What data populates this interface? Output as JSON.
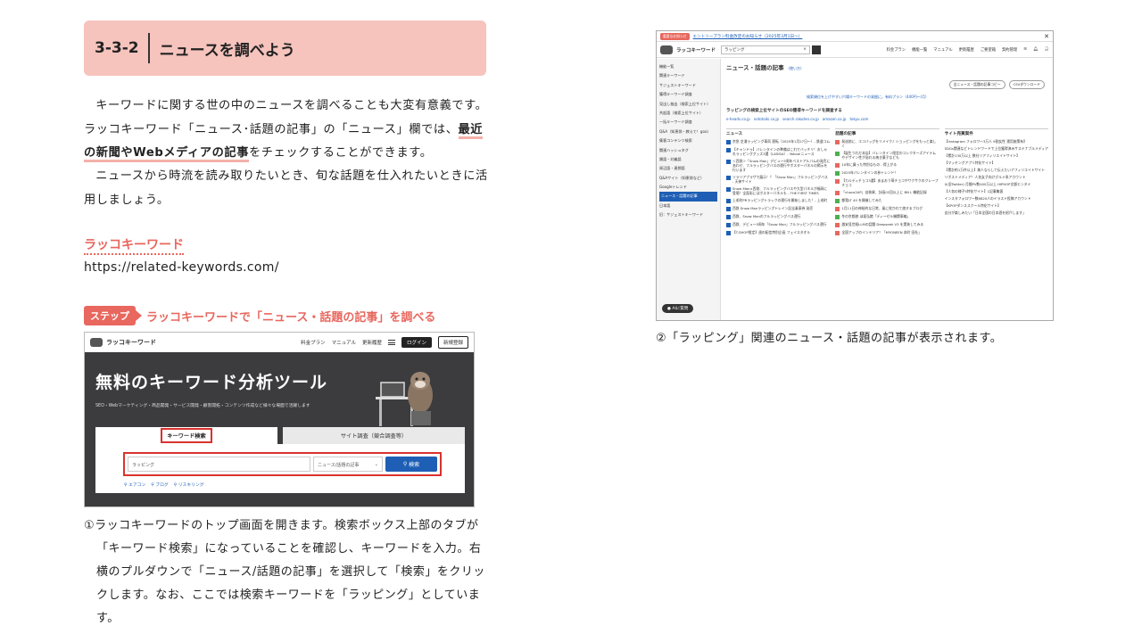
{
  "section": {
    "number": "3-3-2",
    "title": "ニュースを調べよう"
  },
  "body": {
    "para1_a": "キーワードに関する世の中のニュースを調べることも大変有意義です。ラッコキーワード「ニュース･話題の記事」の「ニュース」欄では、",
    "para1_highlight": "最近の新聞やWebメディアの記事",
    "para1_b": "をチェックすることができます。",
    "para2": "ニュースから時流を読み取りたいとき、旬な話題を仕入れたいときに活用しましょう。"
  },
  "resource": {
    "label": "ラッコキーワード",
    "url": "https://related-keywords.com/"
  },
  "step": {
    "badge": "ステップ",
    "text": "ラッコキーワードで「ニュース・話題の記事」を調べる"
  },
  "shot1": {
    "logo": "ラッコキーワード",
    "nav": [
      "料金プラン",
      "マニュアル",
      "更新履歴"
    ],
    "login": "ログイン",
    "register": "新規登録",
    "hero_title": "無料のキーワード分析ツール",
    "hero_sub": "SEO・Webマーケティング・商品開発・サービス開発・顧客開拓・コンテンツ作成など様々な場面で活躍します",
    "tab_active": "キーワード検索",
    "tab_inactive": "サイト調査（競合調査等）",
    "search_value": "ラッピング",
    "select_value": "ニュース/話題の記事",
    "search_button": "検索",
    "links": [
      "エアコン",
      "ブログ",
      "リスキリング"
    ]
  },
  "caption1": "①ラッコキーワードのトップ画面を開きます。検索ボックス上部のタブが「キーワード検索」になっていることを確認し、キーワードを入力。右横のプルダウンで「ニュース/話題の記事」を選択して「検索」をクリックします。なお、ここでは検索キーワードを「ラッピング」としています。",
  "shot2": {
    "notice_badge": "重要なお知らせ",
    "notice_text": "エントリープラン料金改定のお知らせ（2025年3月1日～）",
    "logo": "ラッコキーワード",
    "search_value": "ラッピング",
    "nav": [
      "料金プラン",
      "機能一覧",
      "マニュアル",
      "更新履歴",
      "ご要望箱",
      "契約管理"
    ],
    "sidebar": [
      "機能一覧",
      "関連キーワード",
      "サジェストキーワード",
      "獲得キーワード調査",
      "見出し抽出（検索上位サイト）",
      "共起語（検索上位サイト）",
      "一括キーワード調査",
      "Q&A（知恵袋・教えて！goo）",
      "集客コンテンツ検索",
      "関連ハッシュタグ",
      "類語・対義語",
      "周辺語・連想語",
      "Q&Aサイト（知恵袋など）",
      "Googleトレンド",
      "ニュース・話題の記事",
      "日本語",
      "旧：サジェストキーワード"
    ],
    "ai_label": "AIに質問",
    "title": "ニュース・話題の記事",
    "title_note": "（使い方）",
    "btn_copy": "全ニュース・話題の記事コピー",
    "btn_csv": "CSVダウンロード",
    "promo": "検索順位を上げやすい穴場キーワードの発掘に。有料プラン（440円〜/月）",
    "h2": "ラッピングの検索上位サイトのSEO獲得キーワードを調査する",
    "sites": [
      "e-heads.co.jp",
      "nototoiki.co.jp",
      "search.rakuten.co.jp",
      "amazon.co.jp",
      "tokyu.com"
    ],
    "col_news": "ニュース",
    "col_topics": "話題の記事",
    "col_ranking": "サイト売買案件",
    "news": [
      "京急 芝浦ラッピング車両 運転（2025年1月27日～）- 鉄道コム",
      "【キャンドゥ】バレンタインの準備はこれでバッチリ！おしゃれラッピンググッズ3選（LASISA）- Yahoo!ニュース",
      "＜西鉄＞「Snow Man」デビュー5周年ベストアルバムの発売にあわせ、フルラッピングバスの運行やポスターパネルの掲示を行います",
      "ソラリアプラザで展示！？「Snow Man」フルラッピングバス - 天神サイト",
      "Snow Man×西鉄、フルラッピングバスや大型パネルが福岡に登場！全面彩にはポスターパネルも - THE FIRST TIMES",
      "上毛町PRラッピングトラックの運行を開始しました！- 上毛町",
      "西鉄 Snow Manラッピングトレイン記念乗車券 発売",
      "西鉄、Snow Manのフルラッピングバス運行",
      "西鉄、デビュー5周年「Snow Man」フルラッピングバス運行",
      "【T-SHOP限定】週の配信特別企画 フェイスタオル"
    ],
    "topics": [
      "発送前に、エコバッグをリメイク♪ ショッピングをもっと楽しく",
      "【誕生うれだ本店】バレンタイン限定のコレクターズアイテムやデザイン性が溢れる焼き菓子なども",
      "10年に買った特別なもの - 得上がる",
      "2025年バレンタインの参トレンド！",
      "【カルディチョコ3選】あまおう苺チョコやサクサクのクレープチョコ",
      "「choco2AP」自装貨、計画02回以上に BN L 機能記録",
      "都電LT 40 を開催してみた",
      "1月11日の神秘的な日常、風に吹かれて旅するブログ",
      "冬の京都旅 ほ坂弘館「ディーゼル機関車編」",
      "激安見世紙LLMの話題 Deepseek V3 を実装してみる",
      "全国アップのインテリア！「MYONEEN 本町 田杜」"
    ],
    "ranking": [
      "【Instagram フォロワー3万人 9割女性 運用施策有】",
      "SDGs関連などトレンドワードで上位獲得済みサステナブルメディア",
      "【累計130万以上 数社リアフィリエイトサイト】",
      "【マッチングアプリ特化サイト】",
      "【累計約1万件以上】美人ならして伝えたいアフィリエイトサイト",
      "リポストメディア！人気女子向けグルメ系アカウント",
      "X(旧Twitter) 月間PV数400万以上 HIPHOP文脈エンタメ",
      "【人気の様子5特化サイト】1記事集客",
      "インスタフォロワー数6820人のイラスト投稿アカウント",
      "【KPOPダンススクール特化サイト】",
      "自分が楽しみたい「日本全国の日本酒を紹介します」"
    ]
  },
  "caption2": "②「ラッピング」関連のニュース・話題の記事が表示されます。",
  "colors": {
    "header_bg": "#f6c3bd",
    "accent": "#e8675e",
    "highlight_red": "#d9332d",
    "link_blue": "#1e5fb5"
  }
}
